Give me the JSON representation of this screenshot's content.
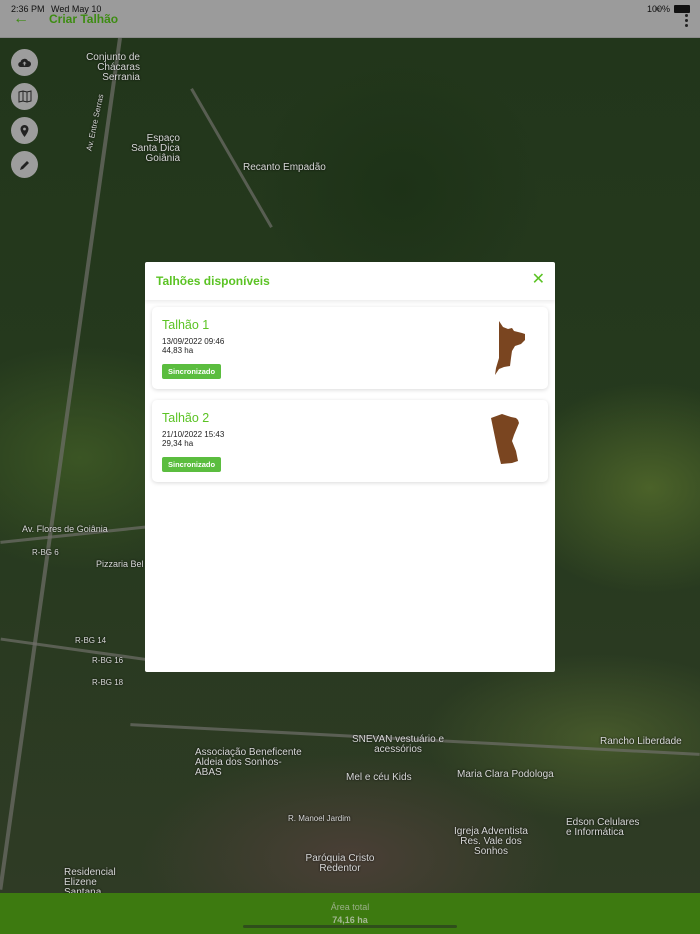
{
  "status": {
    "time": "2:36 PM",
    "date": "Wed May 10",
    "battery": "100%"
  },
  "header": {
    "title": "Criar Talhão",
    "back_icon": "arrow-left-icon",
    "menu_icon": "more-vertical-icon"
  },
  "tools": [
    {
      "icon": "cloud-upload-icon"
    },
    {
      "icon": "map-icon"
    },
    {
      "icon": "location-pin-icon"
    },
    {
      "icon": "pencil-icon"
    }
  ],
  "map_labels": [
    "Conjunto de Chácaras Serrania",
    "Espaço Santa Dica Goiânia",
    "Recanto Empadão",
    "Av. Entre Serras",
    "Av. Flores de Goiânia",
    "R-BG 6",
    "Pizzaria Bel",
    "R-BG 14",
    "R-BG 16",
    "R-BG 18",
    "Associação Beneficente Aldeia dos Sonhos-ABAS",
    "SNEVAN vestuário e acessórios",
    "Mel e céu Kids",
    "Maria Clara Podologa",
    "Rancho Liberdade",
    "Edson Celulares e Informática",
    "Igreja Adventista Res. Vale dos Sonhos",
    "Paróquia Cristo Redentor",
    "Residencial Elizene Santana",
    "R. Manoel Jardim"
  ],
  "modal": {
    "title": "Talhões disponíveis",
    "close_icon": "close-icon",
    "items": [
      {
        "name": "Talhão 1",
        "date": "13/09/2022 09:46",
        "area": "44,83 ha",
        "status": "Sincronizado"
      },
      {
        "name": "Talhão 2",
        "date": "21/10/2022 15:43",
        "area": "29,34 ha",
        "status": "Sincronizado"
      }
    ]
  },
  "footer": {
    "label": "Área total",
    "value": "74,16 ha"
  },
  "colors": {
    "accent": "#5bc324",
    "shape": "#7a4520",
    "bottom": "#3d7a10"
  }
}
